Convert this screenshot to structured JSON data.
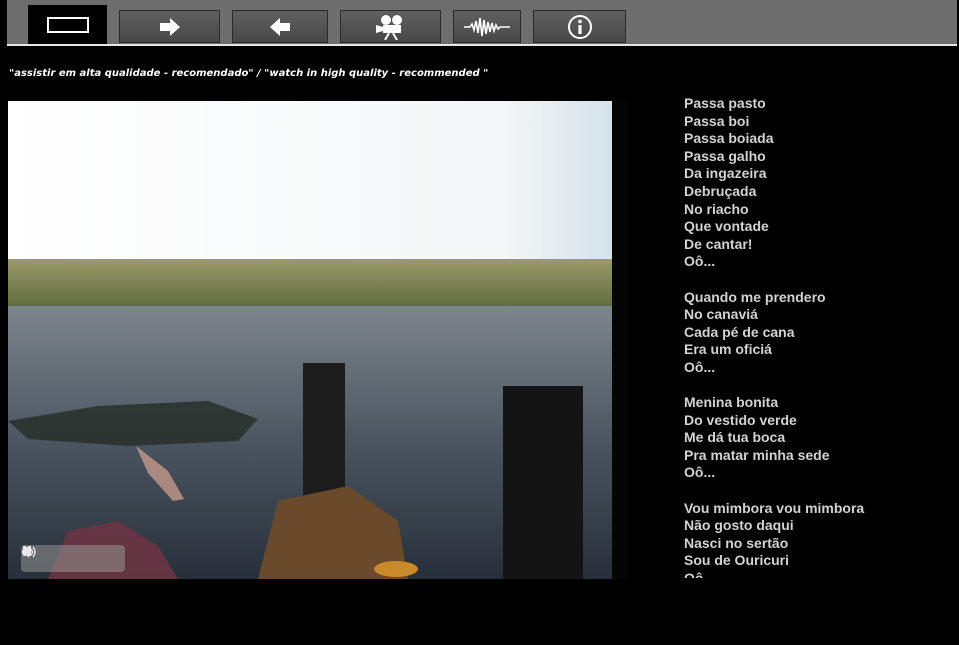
{
  "nav": {
    "tabs": [
      {
        "icon": "rectangle-icon",
        "active": true
      },
      {
        "icon": "arrow-right-icon",
        "active": false
      },
      {
        "icon": "arrow-left-icon",
        "active": false
      },
      {
        "icon": "film-camera-icon",
        "active": false
      },
      {
        "icon": "waveform-icon",
        "active": false
      },
      {
        "icon": "info-icon",
        "active": false
      }
    ]
  },
  "note": "\"assistir em alta qualidade - recomendado\" / \"watch in high quality - recommended \"",
  "video": {
    "controls": [
      "play-icon",
      "pause-icon",
      "stop-icon",
      "volume-icon"
    ]
  },
  "lyrics": {
    "stanzas": [
      [
        "Passa pasto",
        "Passa boi",
        "Passa boiada",
        "Passa galho",
        "Da ingazeira",
        "Debruçada",
        "No riacho",
        "Que vontade",
        "De cantar!",
        "Oô..."
      ],
      [
        "Quando me prendero",
        "No canaviá",
        "Cada pé de cana",
        "Era um oficiá",
        "Oô..."
      ],
      [
        "Menina bonita",
        "Do vestido verde",
        "Me dá tua boca",
        "Pra matar minha sede",
        "Oô..."
      ],
      [
        "Vou mimbora vou mimbora",
        "Não gosto daqui",
        "Nasci no sertão",
        "Sou de Ouricuri",
        "Oô..."
      ]
    ]
  },
  "colors": {
    "tab_bg": "#555555",
    "strip": "#6e6e6e",
    "lyrics_text": "#d2d2d2"
  }
}
